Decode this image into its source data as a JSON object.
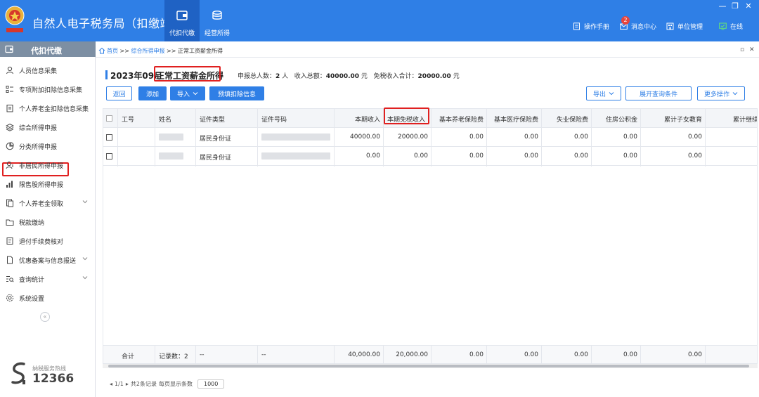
{
  "app": {
    "title": "自然人电子税务局（扣缴端）"
  },
  "modules": [
    {
      "label": "代扣代缴"
    },
    {
      "label": "经营所得"
    }
  ],
  "header_links": {
    "manual": "操作手册",
    "messages": "消息中心",
    "messages_badge": "2",
    "unit": "单位管理",
    "online": "在线"
  },
  "sidebar": {
    "heading": "代扣代缴",
    "items": [
      {
        "label": "人员信息采集"
      },
      {
        "label": "专项附加扣除信息采集"
      },
      {
        "label": "个人养老金扣除信息采集"
      },
      {
        "label": "综合所得申报"
      },
      {
        "label": "分类所得申报"
      },
      {
        "label": "非居民所得申报"
      },
      {
        "label": "限售股所得申报"
      },
      {
        "label": "个人养老金领取"
      },
      {
        "label": "税款缴纳"
      },
      {
        "label": "退付手续费核对"
      },
      {
        "label": "优惠备案与信息报送"
      },
      {
        "label": "查询统计"
      },
      {
        "label": "系统设置"
      }
    ],
    "collapse": "«",
    "hotline_label": "纳税服务热线",
    "hotline": "12366"
  },
  "breadcrumb": {
    "home": "首页",
    "sep": ">>",
    "level1": "综合所得申报",
    "level2": "正常工资薪金所得"
  },
  "page": {
    "period": "2023年09月",
    "income_type": "正常工资薪金所得",
    "stats_people_label": "申报总人数：",
    "stats_people_value": "2",
    "stats_people_unit": "人",
    "stats_income_label": "收入总额：",
    "stats_income_value": "40000.00",
    "stats_income_unit": "元",
    "stats_exempt_label": "免税收入合计：",
    "stats_exempt_value": "20000.00",
    "stats_exempt_unit": "元"
  },
  "toolbar": {
    "back": "返回",
    "add": "添加",
    "import": "导入",
    "prefill": "预填扣除信息",
    "export": "导出",
    "expand_query": "展开查询条件",
    "more": "更多操作"
  },
  "table": {
    "columns": [
      "工号",
      "姓名",
      "证件类型",
      "证件号码",
      "本期收入",
      "本期免税收入",
      "基本养老保险费",
      "基本医疗保险费",
      "失业保险费",
      "住房公积金",
      "累计子女教育",
      "累计继续"
    ],
    "rows": [
      {
        "id_type": "居民身份证",
        "income": "40000.00",
        "exempt": "20000.00",
        "pension": "0.00",
        "medical": "0.00",
        "unemployment": "0.00",
        "housing": "0.00",
        "child_edu": "0.00"
      },
      {
        "id_type": "居民身份证",
        "income": "0.00",
        "exempt": "0.00",
        "pension": "0.00",
        "medical": "0.00",
        "unemployment": "0.00",
        "housing": "0.00",
        "child_edu": "0.00"
      }
    ],
    "footer": {
      "label": "合计",
      "record_count": "记录数：2",
      "id_type": "--",
      "id_no": "--",
      "income": "40,000.00",
      "exempt": "20,000.00",
      "pension": "0.00",
      "medical": "0.00",
      "unemployment": "0.00",
      "housing": "0.00",
      "child_edu": "0.00"
    }
  },
  "pager": {
    "page": "1/1",
    "total": "共2条记录",
    "per_page_label": "每页显示条数",
    "per_page": "1000"
  },
  "colors": {
    "primary": "#2f7fe6",
    "highlight": "#e02020",
    "sidebar_head": "#7d8fa3"
  }
}
